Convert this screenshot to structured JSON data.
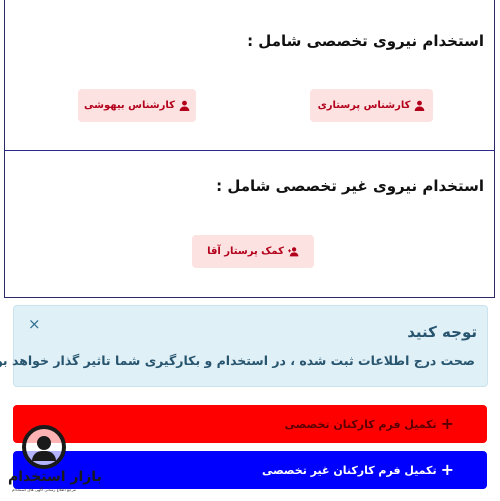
{
  "specialist_section": {
    "heading": "استخدام نیروی تخصصی شامل :",
    "buttons": [
      {
        "label": "کارشناس پرستاری",
        "icon": "user-icon"
      },
      {
        "label": "کارشناس بیهوشی",
        "icon": "user-icon"
      }
    ]
  },
  "nonspecialist_section": {
    "heading": "استخدام نیروی غیر تخصصی شامل :",
    "buttons": [
      {
        "label": "کمک پرستار آقا",
        "icon": "user-plus-icon"
      }
    ]
  },
  "alert": {
    "close": "×",
    "title": "توجه کنید",
    "text": "صحت درج اطلاعات ثبت شده ، در استخدام و بکارگیری شما تاثیر گذار خواهد بود."
  },
  "forms": {
    "plus": "+",
    "specialist_label": "تکمیل فرم کارکنان تخصصی",
    "nonspecialist_label": "تکمیل فرم کارکنان غیر تخصصی"
  },
  "watermark": {
    "brand": "بازار استخدام",
    "tagline": "مرجع اطلاع رسانی آگهی های استخدام"
  },
  "colors": {
    "pill_bg": "#fde2e2",
    "pill_text": "#b3001b",
    "alert_bg": "#dff0f7",
    "bar_red": "#ff0000",
    "bar_blue": "#0000ff"
  }
}
